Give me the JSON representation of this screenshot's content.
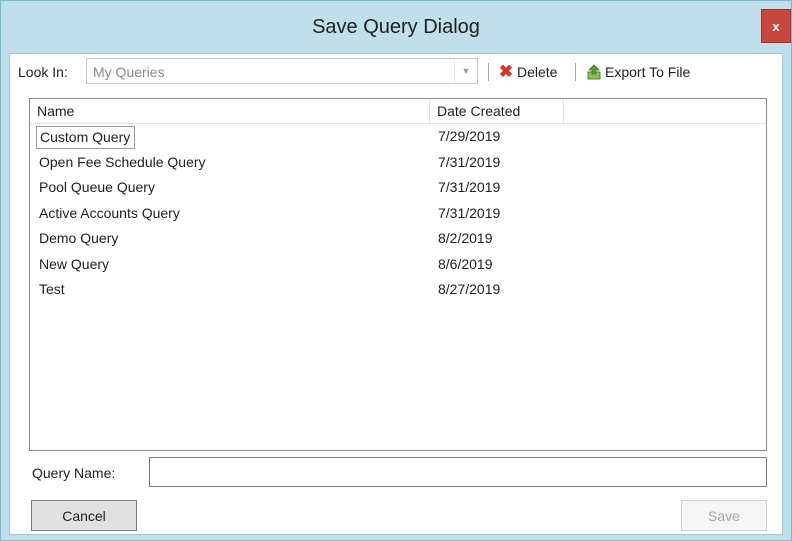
{
  "window": {
    "title": "Save Query Dialog",
    "close_glyph": "x"
  },
  "toolbar": {
    "look_in_label": "Look In:",
    "look_in_value": "My Queries",
    "delete_label": "Delete",
    "export_label": "Export To File",
    "icons": {
      "delete": "delete-x-icon",
      "export": "export-icon"
    }
  },
  "list": {
    "columns": [
      "Name",
      "Date Created"
    ],
    "rows": [
      {
        "name": "Custom Query",
        "date": "7/29/2019"
      },
      {
        "name": "Open Fee Schedule Query",
        "date": "7/31/2019"
      },
      {
        "name": "Pool Queue Query",
        "date": "7/31/2019"
      },
      {
        "name": "Active Accounts Query",
        "date": "7/31/2019"
      },
      {
        "name": "Demo Query",
        "date": "8/2/2019"
      },
      {
        "name": "New Query",
        "date": "8/6/2019"
      },
      {
        "name": "Test",
        "date": "8/27/2019"
      }
    ]
  },
  "form": {
    "query_name_label": "Query Name:",
    "query_name_value": ""
  },
  "buttons": {
    "cancel": "Cancel",
    "save": "Save"
  },
  "colors": {
    "frame": "#bfe0ea",
    "close_button": "#c9463d",
    "delete_icon": "#d9341e",
    "export_icon": "#5a9e3a"
  }
}
